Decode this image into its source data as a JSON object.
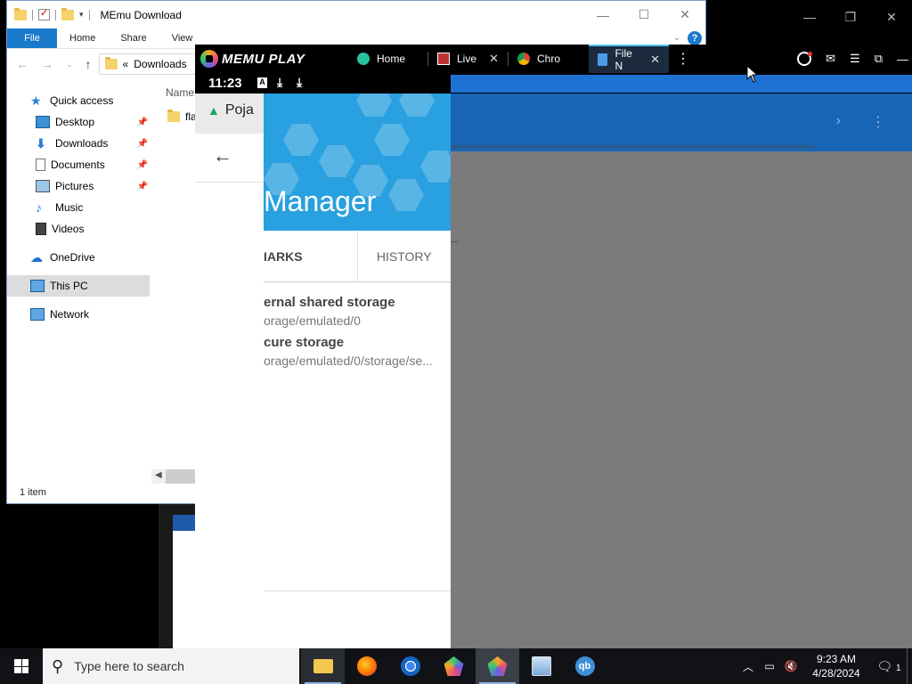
{
  "explorer": {
    "title": "MEmu Download",
    "ribbon_tabs": [
      "File",
      "Home",
      "Share",
      "View"
    ],
    "help": "?",
    "address": "Downloads",
    "address_prefix": "«",
    "column_header": "Name",
    "file_item": "fla",
    "status": "1 item",
    "nav": {
      "quick_access": "Quick access",
      "desktop": "Desktop",
      "downloads": "Downloads",
      "documents": "Documents",
      "pictures": "Pictures",
      "music": "Music",
      "videos": "Videos",
      "onedrive": "OneDrive",
      "this_pc": "This PC",
      "network": "Network"
    }
  },
  "memu": {
    "brand": "MEMU PLAY",
    "tabs": [
      {
        "label": "Home",
        "icon": "home-icon"
      },
      {
        "label": "Live",
        "icon": "live-icon"
      },
      {
        "label": "Chro",
        "icon": "chrome-icon"
      },
      {
        "label": "File N",
        "icon": "file-manager-icon"
      }
    ],
    "status_time": "11:23",
    "chrome_tab": "Poja",
    "drawer": {
      "title": "Manager",
      "tab_bookmarks": "IARKS",
      "tab_history": "HISTORY",
      "storages": [
        {
          "name": "ernal shared storage",
          "path": "orage/emulated/0"
        },
        {
          "name": "cure storage",
          "path": "orage/emulated/0/storage/se..."
        }
      ]
    },
    "accent_color": "#1865b5",
    "drawer_header_color": "#29a0df"
  },
  "taskbar": {
    "search_placeholder": "Type here to search",
    "time": "9:23 AM",
    "date": "4/28/2024",
    "notification_count": "1"
  }
}
